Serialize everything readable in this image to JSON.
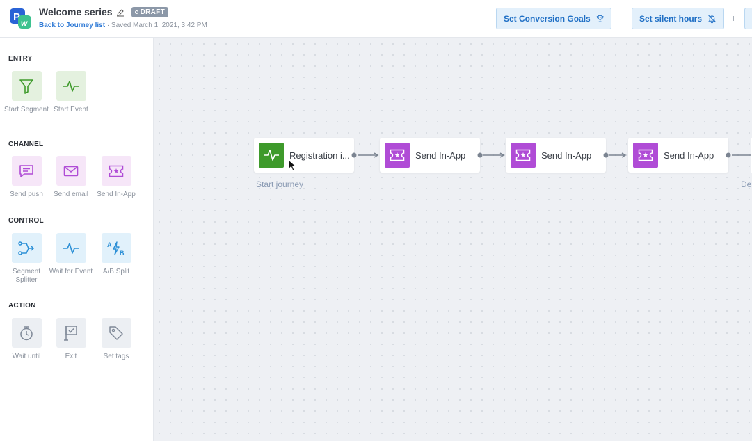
{
  "header": {
    "title": "Welcome series",
    "badge": "DRAFT",
    "back_link": "Back to Journey list",
    "saved_text": "· Saved March 1, 2021, 3:42 PM",
    "buttons": {
      "goals": "Set Conversion Goals",
      "silent": "Set silent hours"
    }
  },
  "sidebar": {
    "sections": {
      "entry": "ENTRY",
      "channel": "CHANNEL",
      "control": "CONTROL",
      "action": "ACTION"
    },
    "tiles": {
      "start_segment": "Start Segment",
      "start_event": "Start Event",
      "send_push": "Send push",
      "send_email": "Send email",
      "send_inapp": "Send In-App",
      "segment_splitter": "Segment Splitter",
      "wait_for_event": "Wait for Event",
      "ab_split": "A/B Split",
      "wait_until": "Wait until",
      "exit": "Exit",
      "set_tags": "Set tags"
    }
  },
  "canvas": {
    "nodes": [
      {
        "label": "Registration i...",
        "icon": "activity-icon"
      },
      {
        "label": "Send In-App",
        "icon": "ticket-star-icon"
      },
      {
        "label": "Send In-App",
        "icon": "ticket-star-icon"
      },
      {
        "label": "Send In-App",
        "icon": "ticket-star-icon"
      }
    ],
    "start_caption": "Start journey",
    "partial_caption": "De"
  },
  "colors": {
    "accent_blue": "#1f6fc5",
    "entry_green": "#3e9a2b",
    "inapp_purple": "#b04cd6"
  }
}
